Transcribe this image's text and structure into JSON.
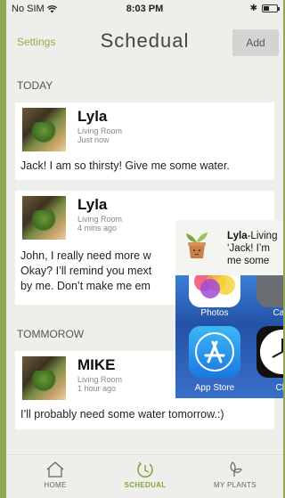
{
  "status_bar": {
    "carrier": "No SIM",
    "time": "8:03 PM"
  },
  "nav": {
    "settings_label": "Settings",
    "title": "Schedual",
    "add_label": "Add"
  },
  "sections": {
    "today": "TODAY",
    "tomorrow": "TOMMOROW"
  },
  "cards": [
    {
      "name": "Lyla",
      "room": "Living Room",
      "ago": "Just now",
      "message": "Jack! I am so thirsty! Give me some water."
    },
    {
      "name": "Lyla",
      "room": "Living Room",
      "ago": "4 mins ago",
      "message_lines": [
        "John, I really need more w",
        "Okay? I’ll remind you mext",
        "by me. Don’t make me em"
      ]
    },
    {
      "name": "MIKE",
      "room": "Living Room",
      "ago": "1 hour ago",
      "message": "I’ll probably need some water tomorrow.:)"
    }
  ],
  "notification": {
    "app_name": "Lyla",
    "line1_rest": "-Living",
    "line2": "‘Jack! I’m",
    "line3": "me some"
  },
  "homescreen": {
    "apps": [
      {
        "label": "Photos",
        "icon": "photos-icon"
      },
      {
        "label": "Cam",
        "icon": "camera-icon"
      },
      {
        "label": "App Store",
        "icon": "app-store-icon"
      },
      {
        "label": "Clo",
        "icon": "clock-icon"
      }
    ]
  },
  "tabs": [
    {
      "label": "HOME",
      "icon": "home-icon",
      "active": false
    },
    {
      "label": "SCHEDUAL",
      "icon": "schedule-icon",
      "active": true
    },
    {
      "label": "MY PLANTS",
      "icon": "plant-icon",
      "active": false
    }
  ],
  "colors": {
    "accent": "#8db24a",
    "background": "#eeeeeb",
    "outer": "#8fa857"
  }
}
